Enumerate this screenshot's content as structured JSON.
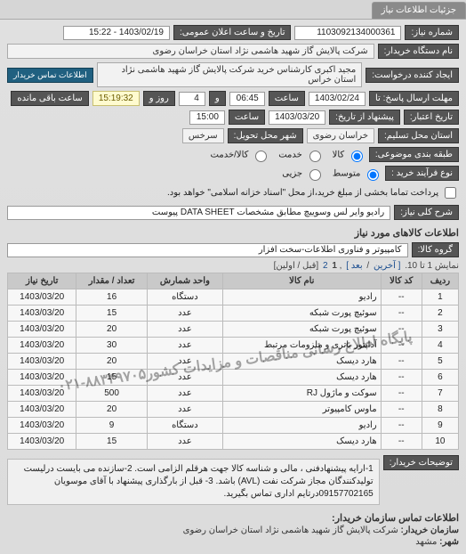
{
  "tab": {
    "label": "جزئیات اطلاعات نیاز"
  },
  "header": {
    "need_no_label": "شماره نیاز:",
    "need_no": "1103092134000361",
    "announce_label": "تاریخ و ساعت اعلان عمومی:",
    "announce_value": "1403/02/19 - 15:22",
    "buyer_org_label": "نام دستگاه خریدار:",
    "buyer_org": "شرکت پالایش گاز شهید هاشمی نژاد   استان خراسان رضوی",
    "requester_label": "ایجاد کننده درخواست:",
    "requester": "مجید اکبری کارشناس خرید شرکت پالایش گاز شهید هاشمی نژاد   استان خراس",
    "contact_btn": "اطلاعات تماس خریدار"
  },
  "deadline": {
    "send_until_label": "مهلت ارسال پاسخ: تا",
    "date": "1403/02/24",
    "time_label": "ساعت",
    "time": "06:45",
    "days_label": "و",
    "days": "4",
    "days_suffix": "روز و",
    "countdown": "15:19:32",
    "remain_label": "ساعت باقی مانده"
  },
  "validity": {
    "label": "تاریخ اعتبار:",
    "from_label": "پیشنهاد از تاریخ:",
    "date": "1403/03/20",
    "time_label": "ساعت",
    "time": "15:00"
  },
  "location": {
    "province_label": "استان محل تسلیم:",
    "province": "خراسان رضوی",
    "city_label": "شهر محل تحویل:",
    "city": "سرخس"
  },
  "packaging": {
    "label": "طبقه بندی موضوعی:",
    "opt_goods": "کالا",
    "opt_service": "خدمت",
    "opt_cash": "کالا/خدمت"
  },
  "process": {
    "label": "نوع فرآیند خرید :",
    "opt_med": "متوسط",
    "opt_small": "جزیی",
    "note": "پرداخت تماما بخشی از مبلغ خرید،از محل \"اسناد خزانه اسلامی\" خواهد بود."
  },
  "main_desc": {
    "label": "شرح کلی نیاز:",
    "value": "رادیو وایر لس وسوییچ مطابق مشخصات DATA SHEET پیوست"
  },
  "goods_section": {
    "title": "اطلاعات کالاهای مورد نیاز",
    "group_label": "گروه کالا:",
    "group_value": "کامپیوتر و فناوری اطلاعات-سخت افزار"
  },
  "pager": {
    "prefix": "نمایش 1 تا 10.",
    "prev": "[ آخرین",
    "next": "بعد ]",
    "p1": "1",
    "p2": "2",
    "suffix": "[قبل / اولین]"
  },
  "table": {
    "headers": {
      "row": "ردیف",
      "code": "کد کالا",
      "name": "نام کالا",
      "unit": "واحد شمارش",
      "qty": "تعداد / مقدار",
      "date": "تاریخ نیاز"
    },
    "rows": [
      {
        "n": "1",
        "code": "--",
        "name": "رادیو",
        "unit": "دستگاه",
        "qty": "16",
        "date": "1403/03/20"
      },
      {
        "n": "2",
        "code": "--",
        "name": "سوئیچ پورت شبکه",
        "unit": "عدد",
        "qty": "15",
        "date": "1403/03/20"
      },
      {
        "n": "3",
        "code": "--",
        "name": "سوئیچ پورت شبکه",
        "unit": "عدد",
        "qty": "20",
        "date": "1403/03/20"
      },
      {
        "n": "4",
        "code": "--",
        "name": "آداپتور باتری و ملزومات مرتبط",
        "unit": "عدد",
        "qty": "30",
        "date": "1403/03/20"
      },
      {
        "n": "5",
        "code": "--",
        "name": "هارد دیسک",
        "unit": "عدد",
        "qty": "20",
        "date": "1403/03/20"
      },
      {
        "n": "6",
        "code": "--",
        "name": "هارد دیسک",
        "unit": "عدد",
        "qty": "15",
        "date": "1403/03/20"
      },
      {
        "n": "7",
        "code": "--",
        "name": "سوکت و ماژول RJ",
        "unit": "عدد",
        "qty": "500",
        "date": "1403/03/20"
      },
      {
        "n": "8",
        "code": "--",
        "name": "ماوس کامپیوتر",
        "unit": "عدد",
        "qty": "20",
        "date": "1403/03/20"
      },
      {
        "n": "9",
        "code": "--",
        "name": "رادیو",
        "unit": "دستگاه",
        "qty": "9",
        "date": "1403/03/20"
      },
      {
        "n": "10",
        "code": "--",
        "name": "هارد دیسک",
        "unit": "عدد",
        "qty": "15",
        "date": "1403/03/20"
      }
    ]
  },
  "watermark": "پایگاه اطلاع رسانی مناقصات و مزایدات کشور‎  ۰۲۱-۸۸۳۴۹۷۰۵",
  "buyer_note": {
    "label": "توضیحات خریدار:",
    "text": "1-ارایه پیشنهادفنی ، مالی و شناسه کالا جهت هرقلم الزامی است. 2-سازنده می بایست درلیست تولیدکنندگان مجاز شرکت نفت (AVL) باشد. 3- قبل از بارگذاری پیشنهاد با آقای موسویان 09157702165درتایم اداری تماس بگیرید."
  },
  "footer": {
    "title": "اطلاعات تماس سازمان خریدار:",
    "org_label": "سازمان خریدار:",
    "org_value": "شرکت پالایش گاز شهید هاشمی نژاد استان خراسان رضوی",
    "city_label": "شهر:",
    "city_value": "مشهد"
  }
}
